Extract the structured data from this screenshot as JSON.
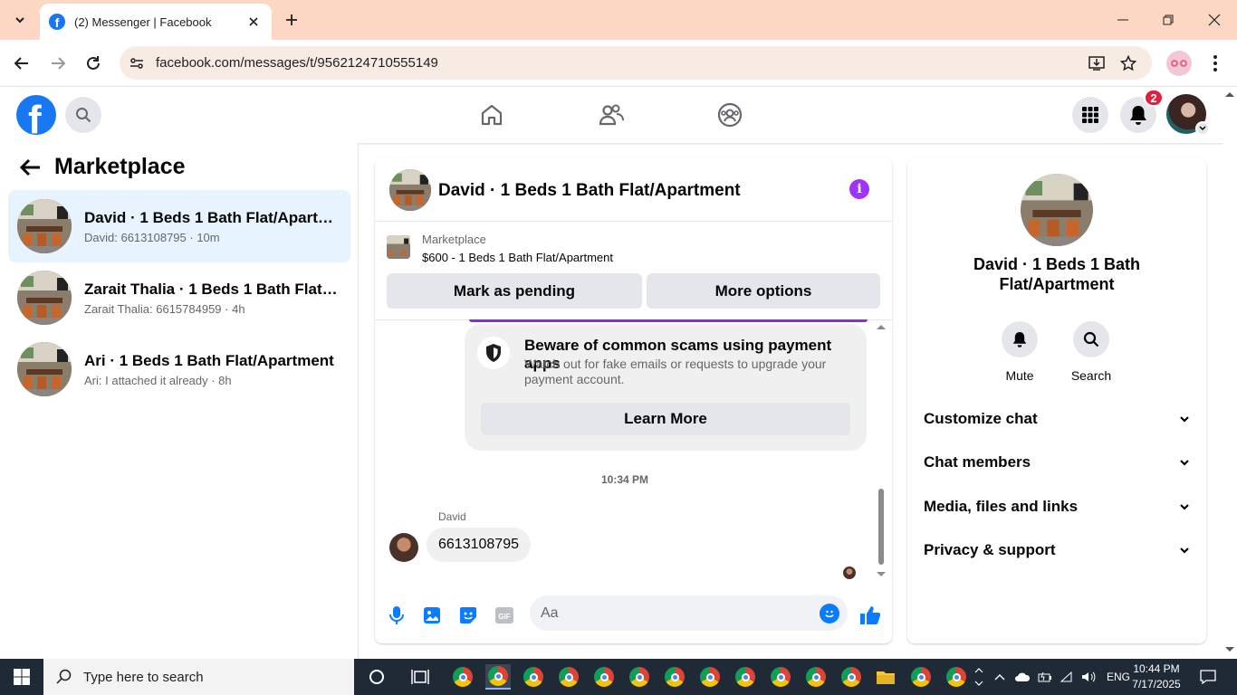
{
  "browser": {
    "tab_title": "(2) Messenger | Facebook",
    "url": "facebook.com/messages/t/9562124710555149"
  },
  "fb_header": {
    "notification_count": "2"
  },
  "left_panel": {
    "title": "Marketplace",
    "conversations": [
      {
        "name": "David · 1 Beds 1 Bath Flat/Apartment",
        "preview": "David: 6613108795 · 10m",
        "active": true
      },
      {
        "name": "Zarait Thalia · 1 Beds 1 Bath Flat/A...",
        "preview": "Zarait Thalia: 6615784959 · 4h",
        "active": false
      },
      {
        "name": "Ari · 1 Beds 1 Bath Flat/Apartment",
        "preview": "Ari: I attached it already · 8h",
        "active": false
      }
    ]
  },
  "chat": {
    "title": "David · 1 Beds 1 Bath Flat/Apartment",
    "listing_category": "Marketplace",
    "listing_price": "$600 - 1 Beds 1 Bath Flat/Apartment",
    "mark_pending_label": "Mark as pending",
    "more_options_label": "More options",
    "warning_title": "Beware of common scams using payment apps",
    "warning_desc": "Watch out for fake emails or requests to upgrade your payment account.",
    "learn_more_label": "Learn More",
    "timestamp": "10:34 PM",
    "sender": "David",
    "message": "6613108795",
    "input_placeholder": "Aa"
  },
  "details_panel": {
    "name": "David · 1 Beds 1 Bath Flat/Apartment",
    "mute_label": "Mute",
    "search_label": "Search",
    "sections": [
      "Customize chat",
      "Chat members",
      "Media, files and links",
      "Privacy & support"
    ]
  },
  "taskbar": {
    "search_placeholder": "Type here to search",
    "language": "ENG",
    "time": "10:44 PM",
    "date": "7/17/2025"
  },
  "colors": {
    "fb_blue": "#1877f2",
    "messenger_purple": "#a033ff",
    "active_row": "#e7f3ff",
    "tab_strip": "#fcd8c4"
  }
}
